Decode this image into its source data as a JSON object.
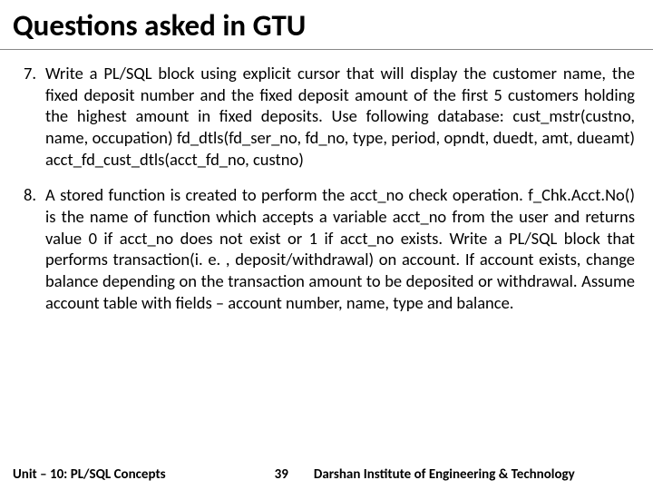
{
  "title": "Questions asked in GTU",
  "items": [
    {
      "num": "7.",
      "text": "Write a PL/SQL block using explicit cursor that will display the customer name, the fixed deposit number and the fixed deposit amount of the first 5 customers holding the highest amount in fixed deposits. Use following database: cust_mstr(custno, name, occupation) fd_dtls(fd_ser_no, fd_no, type, period, opndt, duedt, amt, dueamt) acct_fd_cust_dtls(acct_fd_no, custno)"
    },
    {
      "num": "8.",
      "text": "A stored function is created to perform the acct_no check operation. f_Chk.Acct.No() is the name of function which accepts a variable acct_no from the user and returns value 0 if acct_no does not exist or 1 if acct_no exists. Write a PL/SQL block that performs transaction(i. e. , deposit/withdrawal) on account. If account exists, change balance depending on the transaction amount to be deposited or withdrawal. Assume account table with fields – account number, name, type and balance."
    }
  ],
  "footer": {
    "left": "Unit – 10: PL/SQL Concepts",
    "page": "39",
    "right": "Darshan Institute of Engineering & Technology"
  }
}
